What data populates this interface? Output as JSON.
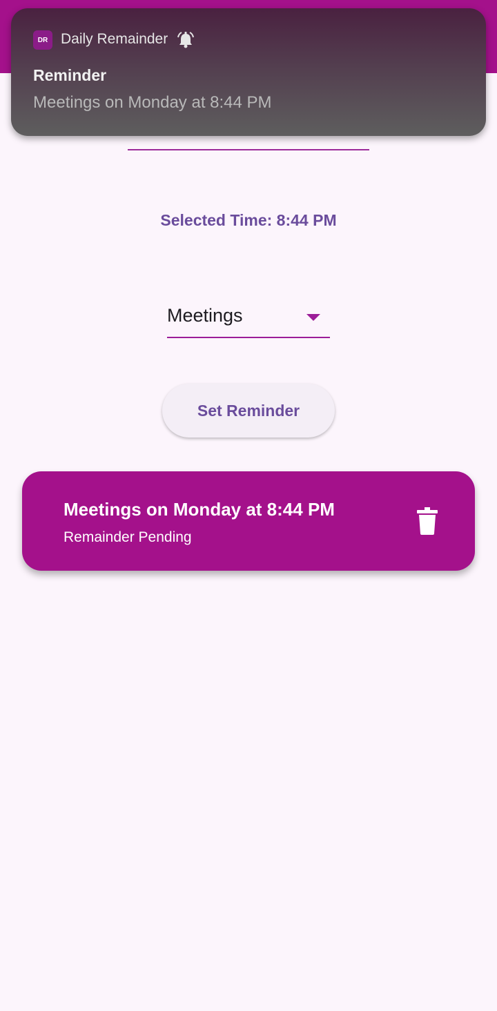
{
  "notification": {
    "app_icon_text": "DR",
    "app_name": "Daily Remainder",
    "title": "Reminder",
    "body": "Meetings on Monday at 8:44 PM",
    "bell_icon": "alarm-bell-icon"
  },
  "form": {
    "selected_time": "Selected Time: 8:44 PM",
    "reminder_type": "Meetings",
    "set_button_label": "Set Reminder"
  },
  "reminders": [
    {
      "title": "Meetings on Monday at 8:44 PM",
      "status": "Remainder Pending",
      "delete_icon": "trash-icon"
    }
  ],
  "colors": {
    "primary": "#a4118b",
    "background": "#fcf5fc",
    "accent_text": "#6a4c9c"
  }
}
